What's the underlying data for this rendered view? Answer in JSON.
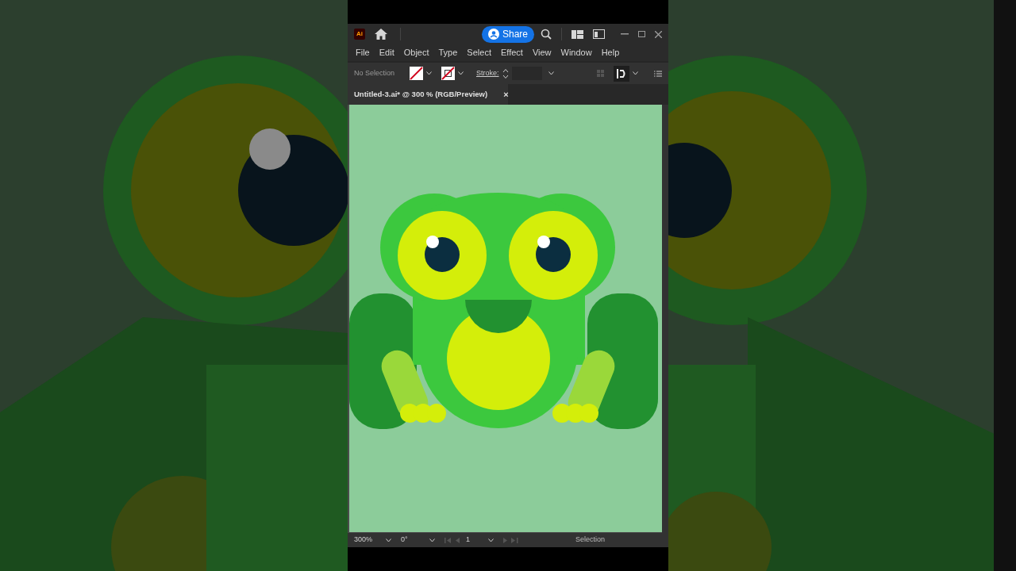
{
  "title_bar": {
    "logo": "Ai",
    "share": "Share"
  },
  "menu": [
    "File",
    "Edit",
    "Object",
    "Type",
    "Select",
    "Effect",
    "View",
    "Window",
    "Help"
  ],
  "control_bar": {
    "selection": "No Selection",
    "stroke_label": "Stroke:"
  },
  "document_tab": {
    "title": "Untitled-3.ai* @ 300 % (RGB/Preview)",
    "close": "×"
  },
  "status_bar": {
    "zoom": "300%",
    "rotation": "0°",
    "artboard": "1",
    "tool": "Selection"
  }
}
